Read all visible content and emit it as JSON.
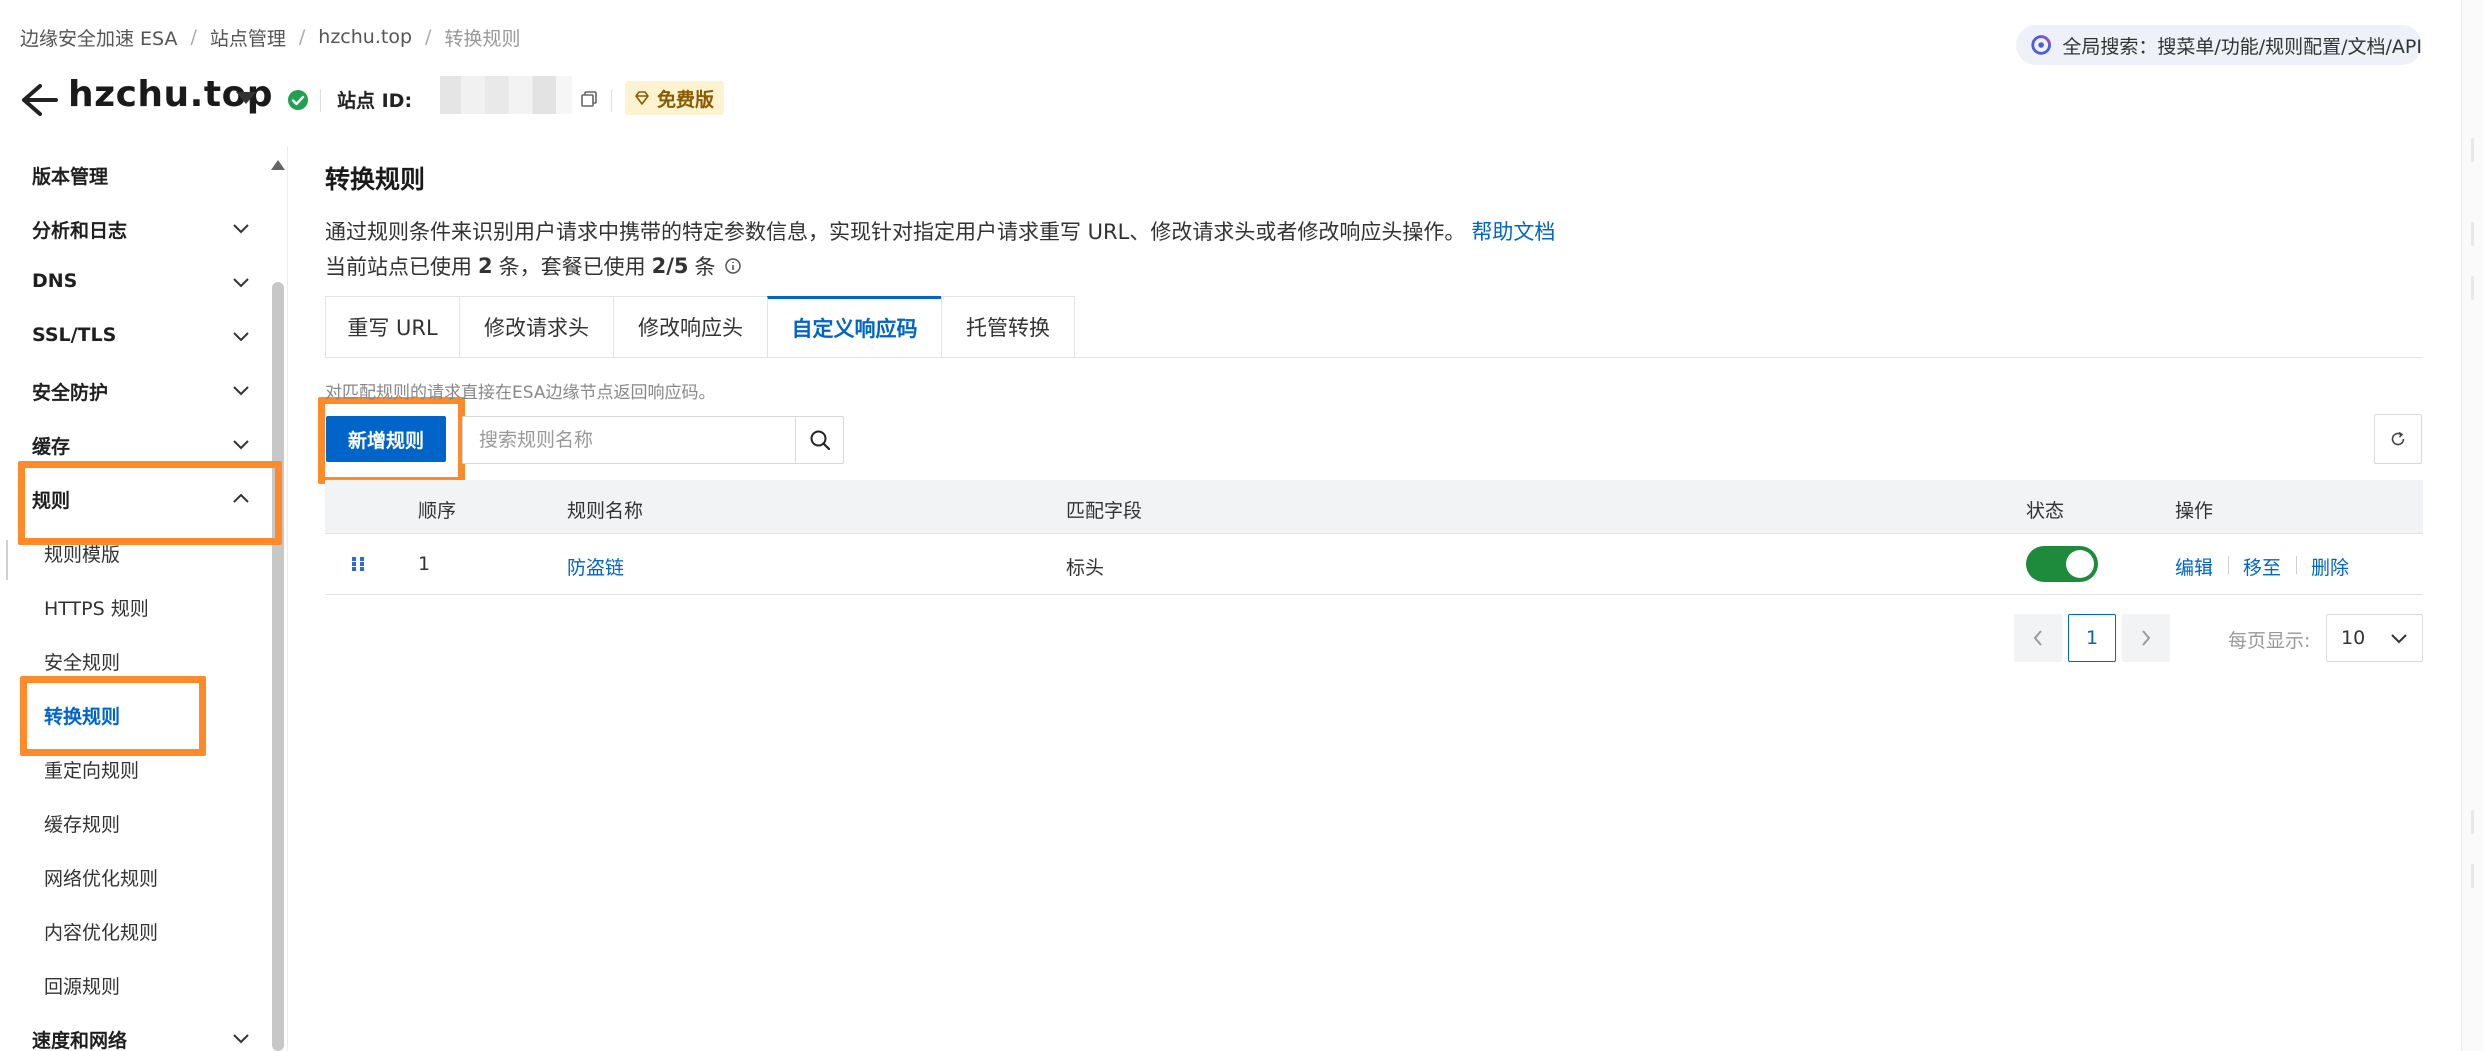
{
  "breadcrumb": {
    "items": [
      "边缘安全加速 ESA",
      "站点管理",
      "hzchu.top",
      "转换规则"
    ],
    "separator": "/"
  },
  "global_search": {
    "label": "全局搜索：搜菜单/功能/规则配置/文档/API",
    "icon": "search-logo-icon"
  },
  "site": {
    "title": "hzchu.top",
    "site_id_label": "站点 ID:",
    "plan_badge": "免费版",
    "status": "active"
  },
  "sidebar": {
    "sections": [
      {
        "label": "版本管理"
      },
      {
        "label": "分析和日志",
        "expandable": true
      },
      {
        "label": "DNS",
        "expandable": true
      },
      {
        "label": "SSL/TLS",
        "expandable": true
      },
      {
        "label": "安全防护",
        "expandable": true
      },
      {
        "label": "缓存",
        "expandable": true
      },
      {
        "label": "规则",
        "expandable": true,
        "expanded": true
      },
      {
        "label": "速度和网络",
        "expandable": true
      }
    ],
    "rules_children": [
      {
        "label": "规则模版"
      },
      {
        "label": "HTTPS 规则"
      },
      {
        "label": "安全规则"
      },
      {
        "label": "转换规则",
        "active": true
      },
      {
        "label": "重定向规则"
      },
      {
        "label": "缓存规则"
      },
      {
        "label": "网络优化规则"
      },
      {
        "label": "内容优化规则"
      },
      {
        "label": "回源规则"
      }
    ]
  },
  "main": {
    "heading": "转换规则",
    "description": "通过规则条件来识别用户请求中携带的特定参数信息，实现针对指定用户请求重写 URL、修改请求头或者修改响应头操作。",
    "help_link": "帮助文档",
    "usage": {
      "prefix": "当前站点已使用",
      "site_used": "2",
      "unit1": "条，套餐已使用",
      "plan_used": "2/5",
      "unit2": "条"
    },
    "tabs": [
      {
        "label": "重写 URL"
      },
      {
        "label": "修改请求头"
      },
      {
        "label": "修改响应头"
      },
      {
        "label": "自定义响应码",
        "active": true
      },
      {
        "label": "托管转换"
      }
    ],
    "tab_hint": "对匹配规则的请求直接在ESA边缘节点返回响应码。",
    "add_button": "新增规则",
    "search_placeholder": "搜索规则名称",
    "table": {
      "columns": [
        "顺序",
        "规则名称",
        "匹配字段",
        "状态",
        "操作"
      ],
      "rows": [
        {
          "order": "1",
          "name": "防盗链",
          "match": "标头",
          "enabled": true,
          "actions": [
            "编辑",
            "移至",
            "删除"
          ]
        }
      ]
    },
    "pagination": {
      "current_page": "1",
      "page_size_label": "每页显示:",
      "page_size": "10"
    }
  },
  "colors": {
    "primary": "#0064c8",
    "highlight": "#ff8a2a",
    "toggle_on": "#1e8a3c",
    "status_ok": "#21a050"
  }
}
